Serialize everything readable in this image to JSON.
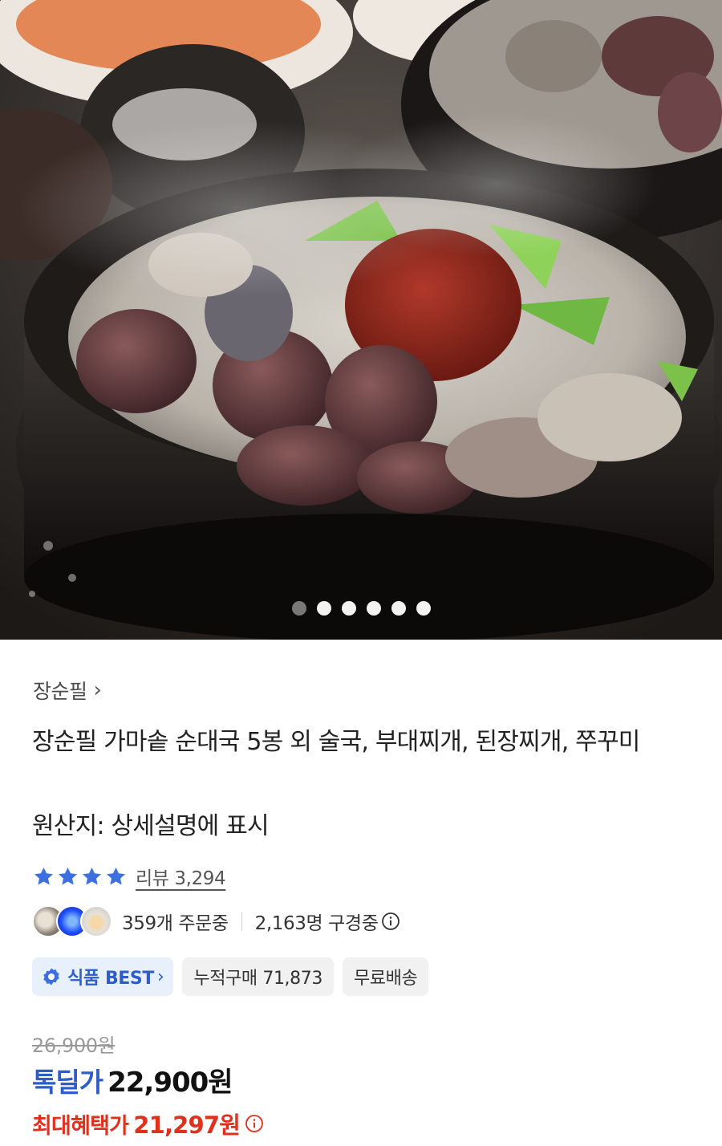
{
  "hero": {
    "image_alt": "순대국",
    "dots_total": 6,
    "active_dot": 1
  },
  "product": {
    "brand": "장순필",
    "brand_chevron": "›",
    "title": "장순필 가마솥 순대국 5봉 외 술국, 부대찌개, 된장찌개, 쭈꾸미",
    "origin": "원산지: 상세설명에 표시",
    "rating_stars": 4,
    "review_label": "리뷰 3,294",
    "ordering": "359개 주문중",
    "viewing": "2,163명 구경중",
    "chips": {
      "best": "식품 BEST",
      "best_chevron": "›",
      "cumulative": "누적구매 71,873",
      "shipping": "무료배송"
    },
    "original_price": "26,900원",
    "deal_label": "톡딜가",
    "deal_price": "22,900원",
    "max_label": "최대혜택가",
    "max_price": "21,297원"
  },
  "colors": {
    "accent_blue": "#2e5dc8",
    "star_blue": "#3d6fe0",
    "max_red": "#e0301e"
  },
  "icons": [
    "star-icon",
    "info-icon",
    "best-badge-icon",
    "chevron-right-icon"
  ]
}
